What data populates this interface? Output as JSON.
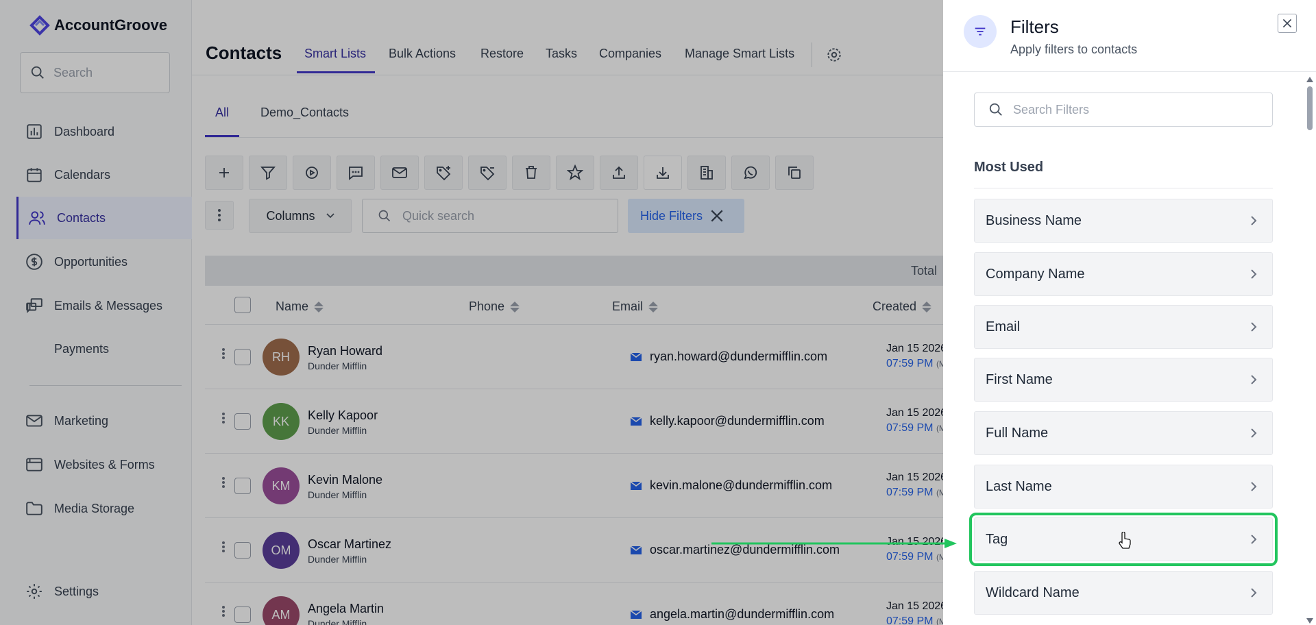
{
  "app": {
    "logo_text": "AccountGroove"
  },
  "sidebar": {
    "search_placeholder": "Search",
    "items": [
      {
        "label": "Dashboard",
        "icon": "bar-chart-icon"
      },
      {
        "label": "Calendars",
        "icon": "calendar-icon"
      },
      {
        "label": "Contacts",
        "icon": "users-icon",
        "active": true
      },
      {
        "label": "Opportunities",
        "icon": "dollar-icon"
      },
      {
        "label": "Emails & Messages",
        "icon": "chat-icon"
      },
      {
        "label": "Payments",
        "icon": ""
      },
      {
        "label": "Marketing",
        "icon": "mail-icon"
      },
      {
        "label": "Websites & Forms",
        "icon": "browser-icon"
      },
      {
        "label": "Media Storage",
        "icon": "folder-icon"
      },
      {
        "label": "Settings",
        "icon": "gear-icon"
      }
    ]
  },
  "header": {
    "title": "Contacts",
    "tabs": [
      "Smart Lists",
      "Bulk Actions",
      "Restore",
      "Tasks",
      "Companies",
      "Manage Smart Lists"
    ],
    "active_tab": "Smart Lists"
  },
  "subtabs": [
    "All",
    "Demo_Contacts"
  ],
  "toolbar": {
    "columns_label": "Columns",
    "quick_search_placeholder": "Quick search",
    "hide_filters_label": "Hide Filters"
  },
  "table": {
    "total_label": "Total",
    "columns": [
      "Name",
      "Phone",
      "Email",
      "Created"
    ],
    "rows": [
      {
        "initials": "RH",
        "name": "Ryan Howard",
        "company": "Dunder Mifflin",
        "email": "ryan.howard@dundermifflin.com",
        "date": "Jan 15 2026",
        "time": "07:59 PM",
        "tz": "(MST",
        "color": "#a16e4e"
      },
      {
        "initials": "KK",
        "name": "Kelly Kapoor",
        "company": "Dunder Mifflin",
        "email": "kelly.kapoor@dundermifflin.com",
        "date": "Jan 15 2026",
        "time": "07:59 PM",
        "tz": "(MST",
        "color": "#5fa04e"
      },
      {
        "initials": "KM",
        "name": "Kevin Malone",
        "company": "Dunder Mifflin",
        "email": "kevin.malone@dundermifflin.com",
        "date": "Jan 15 2026",
        "time": "07:59 PM",
        "tz": "(MST",
        "color": "#9b4f9b"
      },
      {
        "initials": "OM",
        "name": "Oscar Martinez",
        "company": "Dunder Mifflin",
        "email": "oscar.martinez@dundermifflin.com",
        "date": "Jan 15 2026",
        "time": "07:59 PM",
        "tz": "(MST",
        "color": "#5b3f9c"
      },
      {
        "initials": "AM",
        "name": "Angela Martin",
        "company": "Dunder Mifflin",
        "email": "angela.martin@dundermifflin.com",
        "date": "Jan 15 2026",
        "time": "07:59 PM",
        "tz": "(MST",
        "color": "#9b4a6b"
      }
    ]
  },
  "drawer": {
    "title": "Filters",
    "subtitle": "Apply filters to contacts",
    "search_placeholder": "Search Filters",
    "section_title": "Most Used",
    "filters": [
      "Business Name",
      "Company Name",
      "Email",
      "First Name",
      "Full Name",
      "Last Name",
      "Tag",
      "Wildcard Name"
    ],
    "highlighted": "Tag"
  },
  "colors": {
    "accent": "#4338ca",
    "highlight": "#22c55e",
    "link": "#2563eb"
  }
}
